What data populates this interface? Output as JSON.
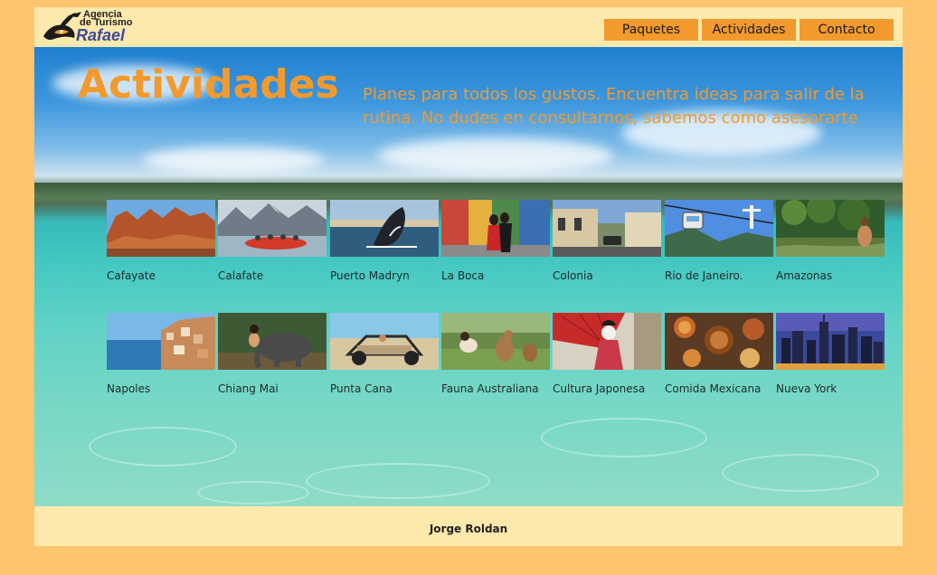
{
  "header": {
    "logo": {
      "line1": "Agencia",
      "line2": "de Turismo",
      "line3": "Rafael"
    },
    "nav": [
      "Paquetes",
      "Actividades",
      "Contacto"
    ]
  },
  "main": {
    "title": "Actividades",
    "subtitle": "Planes para todos los gustos. Encuentra ideas para salir de la rutina. No dudes en consultarnos, sabemos como asesorarte",
    "activities": [
      {
        "label": "Cafayate",
        "icon": "canyon-photo"
      },
      {
        "label": "Calafate",
        "icon": "rafting-photo"
      },
      {
        "label": "Puerto Madryn",
        "icon": "whale-photo"
      },
      {
        "label": "La Boca",
        "icon": "tango-photo"
      },
      {
        "label": "Colonia",
        "icon": "street-photo"
      },
      {
        "label": "Rio de Janeiro.",
        "icon": "cable-car-photo"
      },
      {
        "label": "Amazonas",
        "icon": "jungle-photo"
      },
      {
        "label": "Napoles",
        "icon": "coast-town-photo"
      },
      {
        "label": "Chiang Mai",
        "icon": "elephant-photo"
      },
      {
        "label": "Punta Cana",
        "icon": "buggy-photo"
      },
      {
        "label": "Fauna Australiana",
        "icon": "kangaroo-photo"
      },
      {
        "label": "Cultura Japonesa",
        "icon": "geisha-photo"
      },
      {
        "label": "Comida Mexicana",
        "icon": "food-photo"
      },
      {
        "label": "Nueva York",
        "icon": "skyline-photo"
      }
    ]
  },
  "footer": {
    "author": "Jorge Roldan"
  },
  "colors": {
    "page_background": "#fec46e",
    "header_background": "#fee9ac",
    "accent": "#f29a2e",
    "logo_text": "#3b4b9c"
  }
}
